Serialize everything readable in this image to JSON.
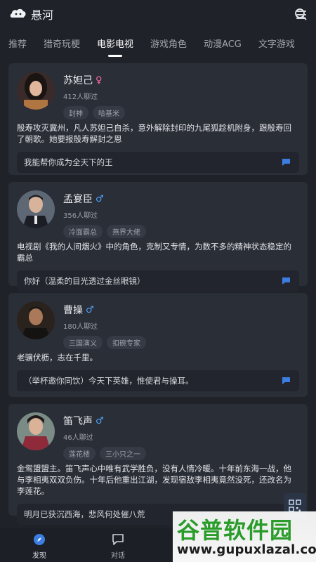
{
  "app": {
    "name": "悬河"
  },
  "tabs": [
    {
      "label": "推荐"
    },
    {
      "label": "猎奇玩梗"
    },
    {
      "label": "电影电视"
    },
    {
      "label": "游戏角色"
    },
    {
      "label": "动漫ACG"
    },
    {
      "label": "文字游戏"
    }
  ],
  "active_tab": "电影电视",
  "cards": [
    {
      "name": "苏妲己",
      "gender": "♀",
      "chats": "412人聊过",
      "tags": [
        "封神",
        "哈基米"
      ],
      "description": "殷寿攻灭冀州，凡人苏妲己自杀，意外解除封印的九尾狐趁机附身，跟殷寿回了朝歌。她要报殷寿解封之恩",
      "quote": "我能帮你成为全天下的王"
    },
    {
      "name": "孟宴臣",
      "gender": "♂",
      "chats": "356人聊过",
      "tags": [
        "冷面霸总",
        "燕界大佬"
      ],
      "description": "电视剧《我的人间烟火》中的角色，克制又专情，为数不多的精神状态稳定的霸总",
      "quote": "你好（温柔的目光透过金丝眼镜）"
    },
    {
      "name": "曹操",
      "gender": "♂",
      "chats": "180人聊过",
      "tags": [
        "三国演义",
        "扣碗专家"
      ],
      "description": "老骥伏枥，志在千里。",
      "quote": "（举杯邀你同饮）今天下英雄，惟使君与操耳。"
    },
    {
      "name": "笛飞声",
      "gender": "♂",
      "chats": "46人聊过",
      "tags": [
        "莲花楼",
        "三小只之一"
      ],
      "description": "金鸳盟盟主。笛飞声心中唯有武学胜负，没有人情冷暖。十年前东海一战，他与李相夷双双负伤。十年后他重出江湖，发现宿敌李相夷竟然没死，还改名为李莲花。",
      "quote": "明月已获沉西海，悲风何处催八荒"
    }
  ],
  "bottom_nav": [
    {
      "label": "发现"
    },
    {
      "label": "对话"
    }
  ],
  "watermark": {
    "title": "谷普软件园",
    "url": "www.gupuxlazal.com"
  },
  "colors": {
    "background": "#1f2229",
    "card": "#2a2e37",
    "accent_blue": "#3b7de0",
    "female": "#ff6aa8",
    "male": "#4ea6ff"
  }
}
